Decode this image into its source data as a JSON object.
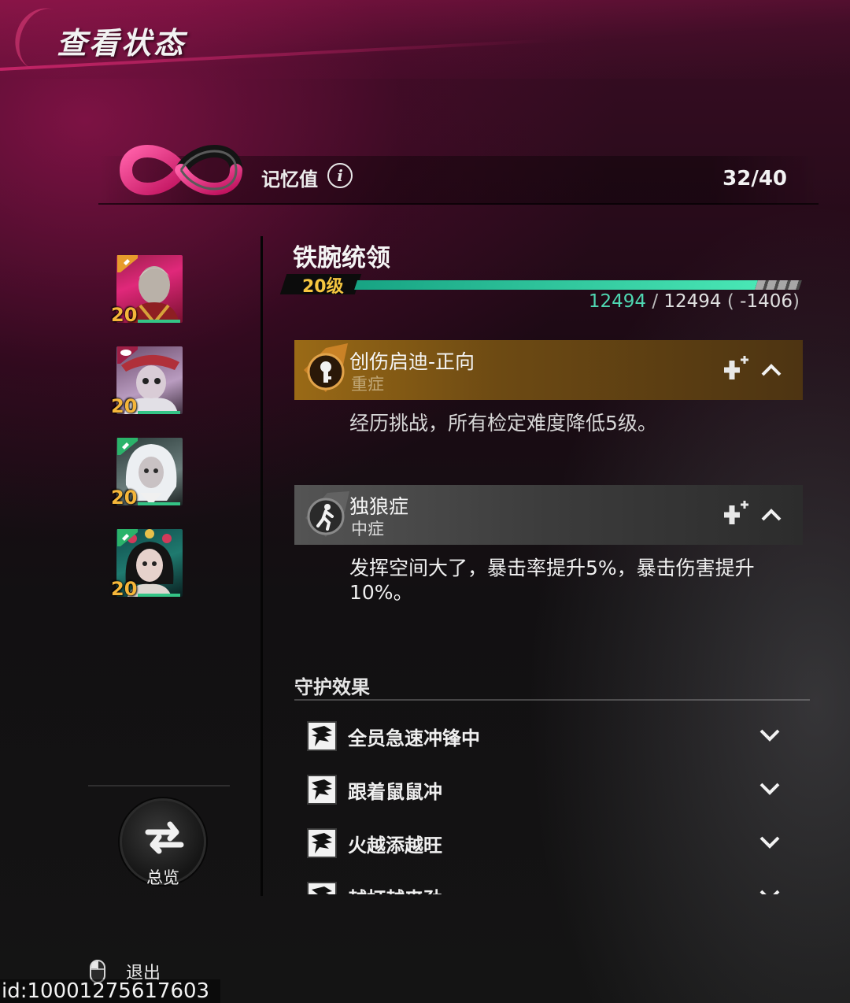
{
  "header": {
    "title": "查看状态"
  },
  "memory": {
    "label": "记忆值",
    "value": "32/40"
  },
  "characters": [
    {
      "level": "20"
    },
    {
      "level": "20"
    },
    {
      "level": "20"
    },
    {
      "level": "20"
    }
  ],
  "character": {
    "name": "铁腕统领",
    "level_label": "20级",
    "xp_current": "12494",
    "xp_max": "12494",
    "xp_delta": "-1406",
    "xp_progress": 0.9
  },
  "traumas": [
    {
      "name": "创伤启迪-正向",
      "severity": "重症",
      "description": "经历挑战，所有检定难度降低5级。"
    },
    {
      "name": "独狼症",
      "severity": "中症",
      "description": "发挥空间大了，暴击率提升5%，暴击伤害提升10%。"
    }
  ],
  "guard": {
    "title": "守护效果",
    "items": [
      {
        "label": "全员急速冲锋中"
      },
      {
        "label": "跟着鼠鼠冲"
      },
      {
        "label": "火越添越旺"
      },
      {
        "label": "越打越来劲"
      }
    ]
  },
  "sidebar": {
    "overview_label": "总览"
  },
  "footer": {
    "exit_label": "退出",
    "id_text": "id:10001275617603"
  },
  "colors": {
    "accent_pink": "#e0287a",
    "xp_green": "#3fd6a7",
    "level_gold": "#f5b63a",
    "trauma_gold": "#9a6a16"
  },
  "icons": {
    "infinity": "infinity-icon",
    "info": "info-icon",
    "overview": "swap-arrows-icon",
    "mouse": "mouse-icon",
    "plus": "add-plus-icon",
    "collapse": "chevron-up-icon",
    "expand": "chevron-down-icon",
    "guard": "wings-icon"
  }
}
